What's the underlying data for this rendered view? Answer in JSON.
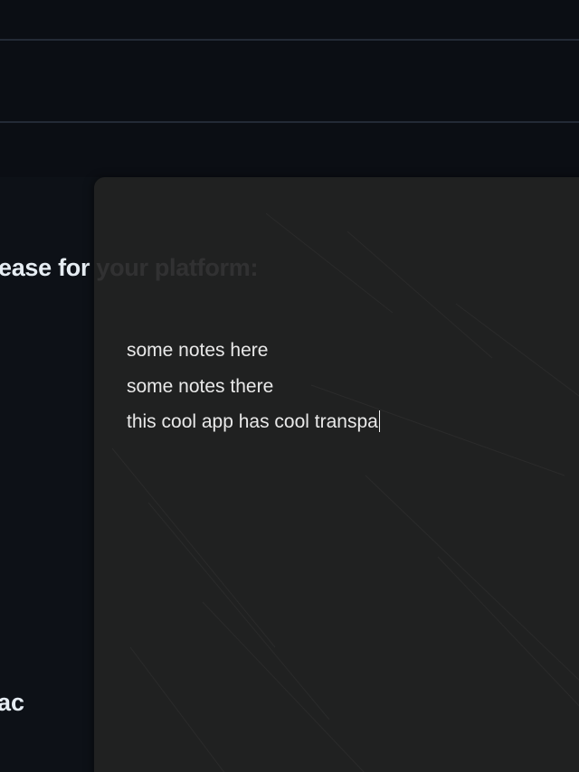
{
  "background_page": {
    "download_heading": "ease for your platform:",
    "platform_label": "ac"
  },
  "notes_app": {
    "lines": [
      "some notes here",
      "some notes there",
      "this cool app has cool transpa"
    ]
  }
}
